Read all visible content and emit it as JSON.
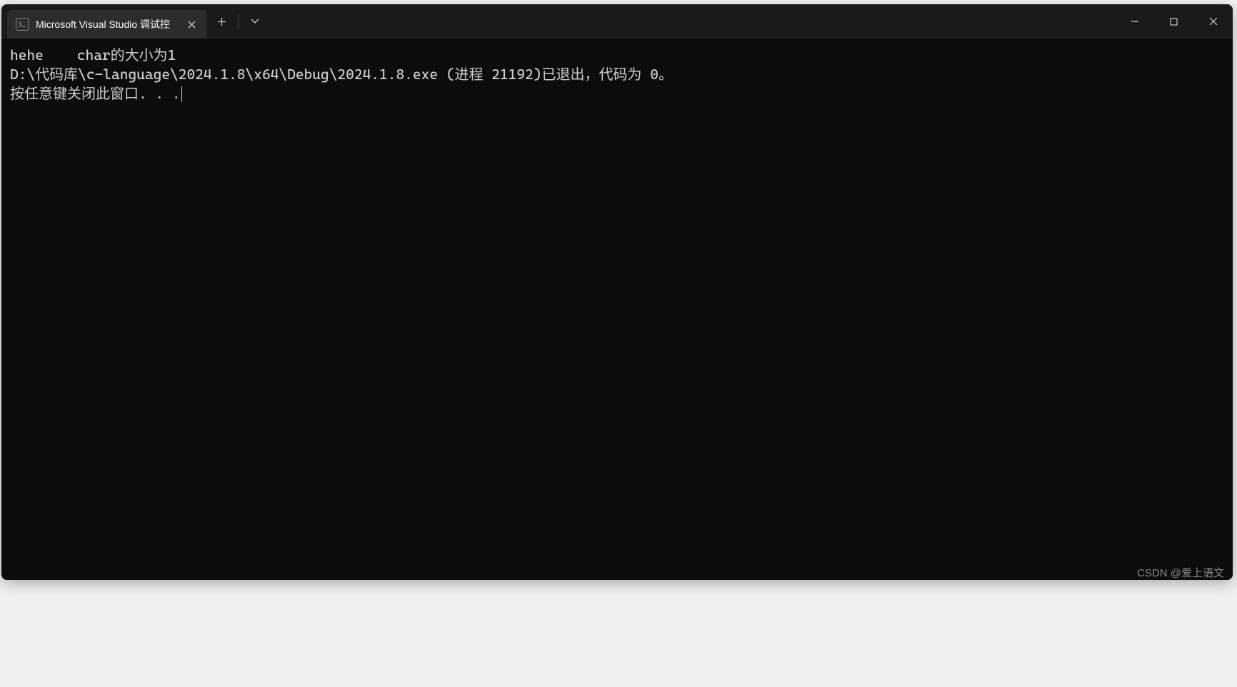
{
  "tab": {
    "title": "Microsoft Visual Studio 调试控"
  },
  "console": {
    "line1": "hehe    char的大小为1",
    "line2": "",
    "line3": "D:\\代码库\\c-language\\2024.1.8\\x64\\Debug\\2024.1.8.exe (进程 21192)已退出，代码为 0。",
    "line4": "按任意键关闭此窗口. . ."
  },
  "watermark": "CSDN @爱上语文"
}
